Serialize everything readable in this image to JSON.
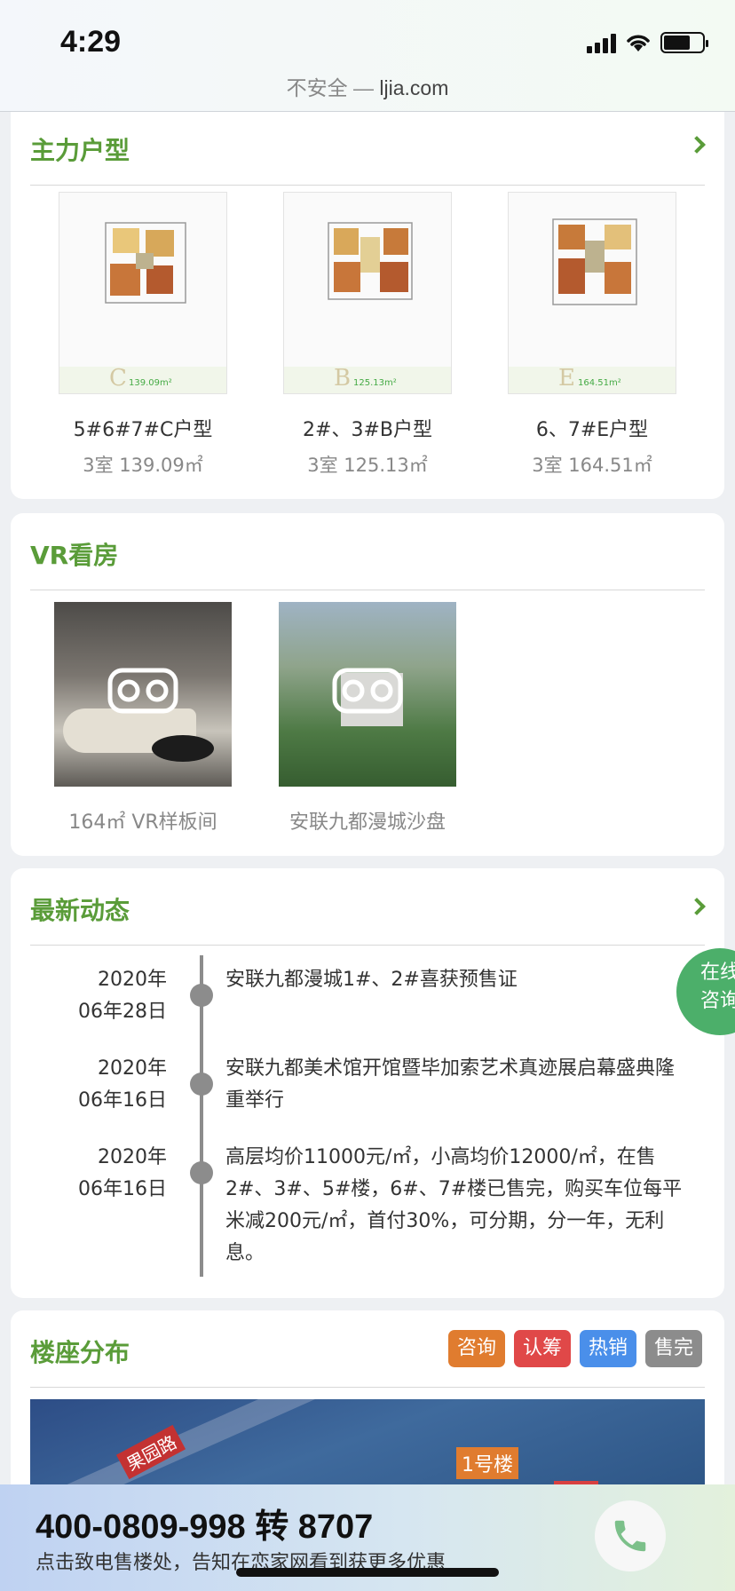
{
  "status_bar": {
    "time": "4:29",
    "url_prefix": "不安全 —",
    "url_domain": "ljia.com"
  },
  "floor_plans": {
    "title": "主力户型",
    "items": [
      {
        "name": "5#6#7#C户型",
        "spec": "3室 139.09㎡",
        "letter": "C",
        "area_tag": "139.09m²"
      },
      {
        "name": "2#、3#B户型",
        "spec": "3室 125.13㎡",
        "letter": "B",
        "area_tag": "125.13m²"
      },
      {
        "name": "6、7#E户型",
        "spec": "3室 164.51㎡",
        "letter": "E",
        "area_tag": "164.51m²"
      }
    ]
  },
  "vr": {
    "title": "VR看房",
    "items": [
      {
        "label": "164㎡ VR样板间"
      },
      {
        "label": "安联九都漫城沙盘"
      }
    ]
  },
  "news": {
    "title": "最新动态",
    "items": [
      {
        "year": "2020年",
        "date": "06年28日",
        "text": "安联九都漫城1#、2#喜获预售证"
      },
      {
        "year": "2020年",
        "date": "06年16日",
        "text": "安联九都美术馆开馆暨毕加索艺术真迹展启幕盛典隆重举行"
      },
      {
        "year": "2020年",
        "date": "06年16日",
        "text": "高层均价11000元/㎡，小高均价12000/㎡，在售2#、3#、5#楼，6#、7#楼已售完，购买车位每平米减200元/㎡，首付30%，可分期，分一年，无利息。"
      }
    ]
  },
  "buildings": {
    "title": "楼座分布",
    "badges": [
      {
        "label": "咨询",
        "color": "#e07c2f"
      },
      {
        "label": "认筹",
        "color": "#e04848"
      },
      {
        "label": "热销",
        "color": "#4a8fea"
      },
      {
        "label": "售完",
        "color": "#8c8c8c"
      }
    ],
    "road_label": "果园路",
    "building_label": "1号楼"
  },
  "online_consult": {
    "line1": "在线",
    "line2": "咨询"
  },
  "footer": {
    "phone": "400-0809-998 转 8707",
    "text": "点击致电售楼处，告知在恋家网看到获更多优惠"
  }
}
